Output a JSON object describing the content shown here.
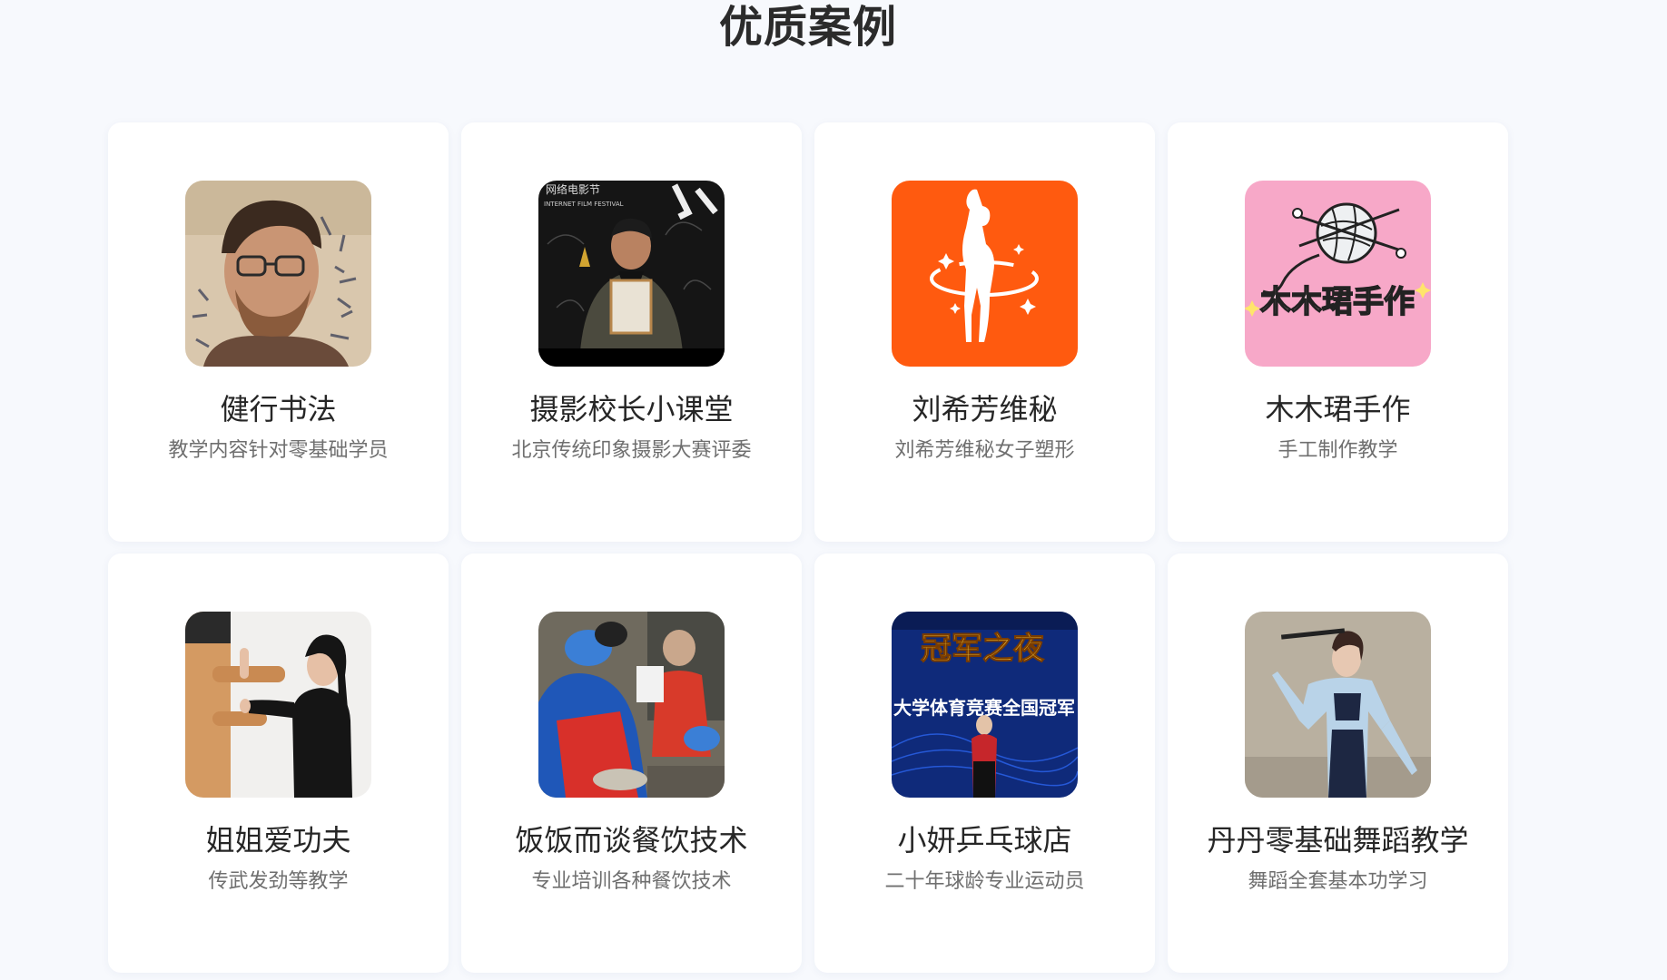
{
  "section": {
    "title": "优质案例"
  },
  "cases": [
    {
      "title": "健行书法",
      "desc": "教学内容针对零基础学员",
      "icon": "portrait-man-glasses"
    },
    {
      "title": "摄影校长小课堂",
      "desc": "北京传统印象摄影大赛评委",
      "icon": "photo-award-ceremony"
    },
    {
      "title": "刘希芳维秘",
      "desc": "刘希芳维秘女子塑形",
      "icon": "silhouette-logo"
    },
    {
      "title": "木木珺手作",
      "desc": "手工制作教学",
      "icon": "yarn-ball-logo"
    },
    {
      "title": "姐姐爱功夫",
      "desc": "传武发劲等教学",
      "icon": "kungfu-wooden-dummy"
    },
    {
      "title": "饭饭而谈餐饮技术",
      "desc": "专业培训各种餐饮技术",
      "icon": "cooking-class-photo"
    },
    {
      "title": "小妍乒乓球店",
      "desc": "二十年球龄专业运动员",
      "icon": "champion-stage-photo"
    },
    {
      "title": "丹丹零基础舞蹈教学",
      "desc": "舞蹈全套基本功学习",
      "icon": "dancer-photo"
    }
  ],
  "images": {
    "photo_award_banner": "网络电影节",
    "photo_award_banner_en": "INTERNET FILM FESTIVAL",
    "yarn_logo_text": "木木珺手作",
    "stage_title": "冠军之夜",
    "stage_subtitle": "大学体育竞赛全国冠军"
  },
  "colors": {
    "background": "#f7f9fd",
    "card": "#ffffff",
    "title": "#262626",
    "desc": "#6f6f6f",
    "orange_logo": "#ff5a0f",
    "pink_logo": "#f7a8c8",
    "stage_blue": "#0f2a7a"
  }
}
